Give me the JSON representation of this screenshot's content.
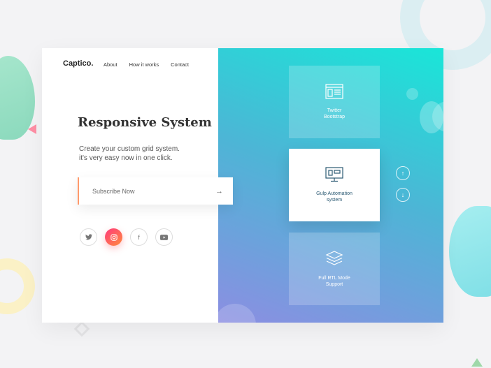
{
  "brand": "Captico.",
  "nav": [
    "About",
    "How it works",
    "Contact"
  ],
  "hero": {
    "title": "Responsive System",
    "subtitle_line1": "Create your custom grid system.",
    "subtitle_line2": "it's very easy now in one click."
  },
  "subscribe": {
    "label": "Subscribe Now",
    "arrow": "→"
  },
  "socials": [
    {
      "name": "twitter",
      "glyph": "🐦"
    },
    {
      "name": "instagram",
      "glyph": "◎"
    },
    {
      "name": "facebook",
      "glyph": "f"
    },
    {
      "name": "youtube",
      "glyph": "▶"
    }
  ],
  "features": [
    {
      "line1": "Twitter",
      "line2": "Bootstrap",
      "icon": "layout-icon"
    },
    {
      "line1": "Gulp Automation",
      "line2": "system",
      "icon": "monitor-icon"
    },
    {
      "line1": "Full RTL Mode",
      "line2": "Support",
      "icon": "layers-icon"
    }
  ],
  "controls": {
    "up": "↑",
    "down": "↓"
  },
  "colors": {
    "accent": "#ff9a6b",
    "gradient_top": "#19e6d8",
    "gradient_bottom": "#8c8ee2",
    "instagram_start": "#ff3b7d",
    "instagram_end": "#ff8a3d"
  }
}
